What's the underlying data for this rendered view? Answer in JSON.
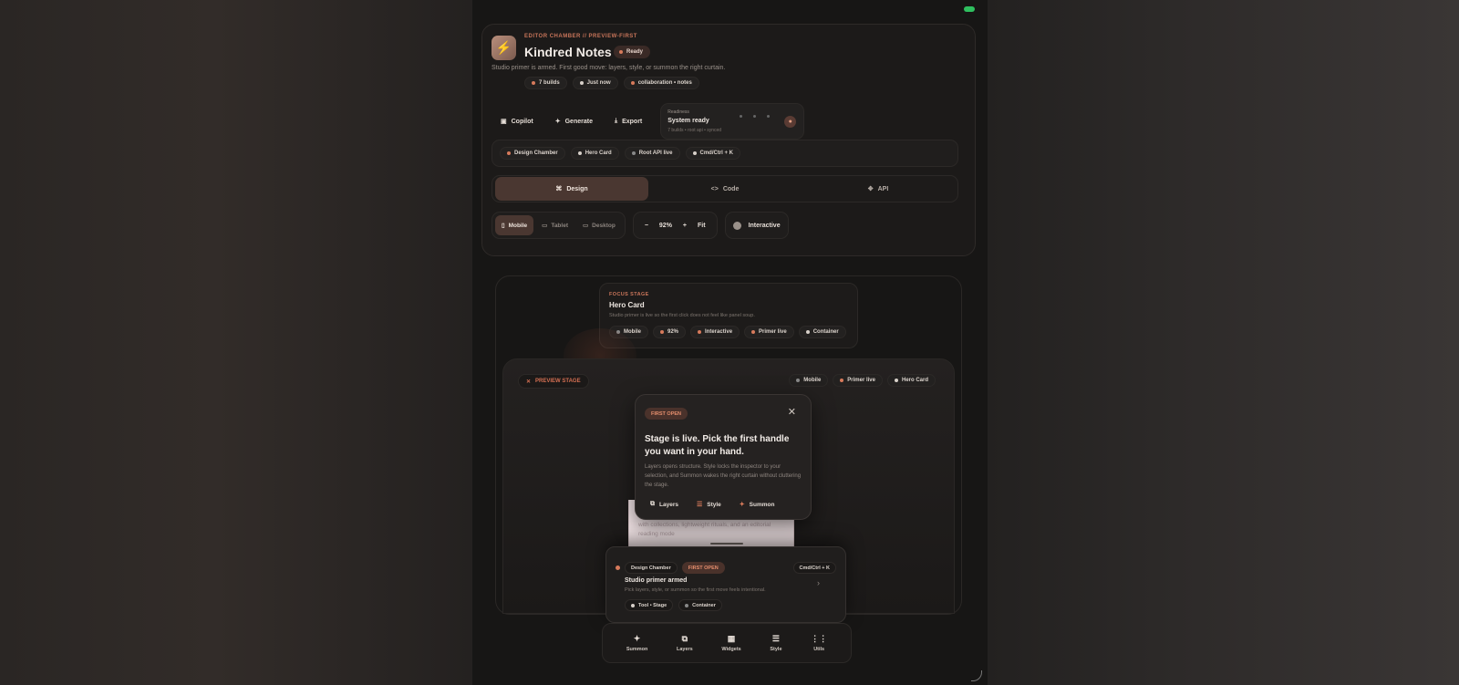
{
  "app": {
    "eyebrow": "EDITOR CHAMBER // PREVIEW-FIRST",
    "title": "Kindred Notes",
    "status": "Ready",
    "subtitle": "Studio primer is armed. First good move: layers, style, or summon the right curtain.",
    "meta": [
      "7 builds",
      "Just now",
      "collaboration • notes"
    ]
  },
  "actions": {
    "copilot": "Copilot",
    "generate": "Generate",
    "export": "Export"
  },
  "readiness": {
    "label": "Readiness",
    "value": "System ready",
    "sub": "7 builds • root api • synced"
  },
  "crumbs": [
    "Design Chamber",
    "Hero Card",
    "Root API live",
    "Cmd/Ctrl + K"
  ],
  "modes": [
    {
      "icon": "⌘",
      "label": "Design"
    },
    {
      "icon": "<>",
      "label": "Code"
    },
    {
      "icon": "✥",
      "label": "API"
    }
  ],
  "devices": [
    {
      "icon": "▯",
      "label": "Mobile"
    },
    {
      "icon": "▭",
      "label": "Tablet"
    },
    {
      "icon": "▭",
      "label": "Desktop"
    }
  ],
  "zoom": {
    "minus": "−",
    "value": "92%",
    "plus": "+",
    "fit": "Fit"
  },
  "interactive_label": "Interactive",
  "focus": {
    "eyebrow": "FOCUS STAGE",
    "title": "Hero Card",
    "desc": "Studio primer is live so the first click does not feel like panel soup.",
    "chips": [
      "Mobile",
      "92%",
      "Interactive",
      "Primer live",
      "Container"
    ]
  },
  "preview": {
    "tag": "PREVIEW STAGE",
    "chips": [
      "Mobile",
      "Primer live",
      "Hero Card"
    ]
  },
  "phone_text": "with collections, lightweight rituals, and an editorial reading mode",
  "popover": {
    "badge": "FIRST OPEN",
    "close": "✕",
    "heading": "Stage is live. Pick the first handle you want in your hand.",
    "body": "Layers opens structure. Style locks the inspector to your selection, and Summon wakes the right curtain without cluttering the stage.",
    "actions": [
      {
        "icon": "⧉",
        "label": "Layers"
      },
      {
        "icon": "☰",
        "label": "Style"
      },
      {
        "icon": "✦",
        "label": "Summon"
      }
    ]
  },
  "primer": {
    "tags": [
      "Design Chamber",
      "FIRST OPEN"
    ],
    "shortcut": "Cmd/Ctrl + K",
    "title": "Studio primer armed",
    "desc": "Pick layers, style, or summon so the first move feels intentional.",
    "chevron": "›",
    "chips": [
      "Tool • Stage",
      "Container"
    ]
  },
  "dock": [
    {
      "icon": "✦",
      "label": "Summon"
    },
    {
      "icon": "⧉",
      "label": "Layers"
    },
    {
      "icon": "▦",
      "label": "Widgets"
    },
    {
      "icon": "☰",
      "label": "Style"
    },
    {
      "icon": "⋮⋮",
      "label": "Utils"
    }
  ],
  "colors": {
    "accent": "#d77a5b",
    "active_tab": "#4a3731",
    "surface": "#1c1a19"
  }
}
